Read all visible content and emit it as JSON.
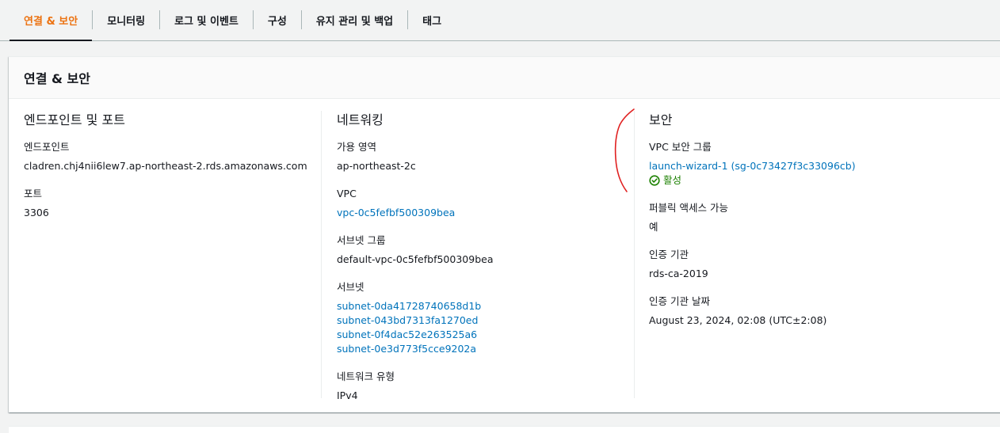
{
  "tabs": [
    {
      "label": "연결 & 보안",
      "active": true
    },
    {
      "label": "모니터링",
      "active": false
    },
    {
      "label": "로그 및 이벤트",
      "active": false
    },
    {
      "label": "구성",
      "active": false
    },
    {
      "label": "유지 관리 및 백업",
      "active": false
    },
    {
      "label": "태그",
      "active": false
    }
  ],
  "panel": {
    "title": "연결 & 보안"
  },
  "endpoint_section": {
    "title": "엔드포인트 및 포트",
    "endpoint_label": "엔드포인트",
    "endpoint_value": "cladren.chj4nii6lew7.ap-northeast-2.rds.amazonaws.com",
    "port_label": "포트",
    "port_value": "3306"
  },
  "networking_section": {
    "title": "네트워킹",
    "az_label": "가용 영역",
    "az_value": "ap-northeast-2c",
    "vpc_label": "VPC",
    "vpc_value": "vpc-0c5fefbf500309bea",
    "subnet_group_label": "서브넷 그룹",
    "subnet_group_value": "default-vpc-0c5fefbf500309bea",
    "subnets_label": "서브넷",
    "subnets": [
      "subnet-0da41728740658d1b",
      "subnet-043bd7313fa1270ed",
      "subnet-0f4dac52e263525a6",
      "subnet-0e3d773f5cce9202a"
    ],
    "network_type_label": "네트워크 유형",
    "network_type_value": "IPv4"
  },
  "security_section": {
    "title": "보안",
    "sg_label": "VPC 보안 그룹",
    "sg_value": "launch-wizard-1 (sg-0c73427f3c33096cb)",
    "sg_status": "활성",
    "public_label": "퍼블릭 액세스 가능",
    "public_value": "예",
    "ca_label": "인증 기관",
    "ca_value": "rds-ca-2019",
    "ca_date_label": "인증 기관 날짜",
    "ca_date_value": "August 23, 2024, 02:08 (UTC±2:08)"
  },
  "colors": {
    "accent": "#ec7211",
    "link": "#0073bb",
    "success": "#1d8102",
    "annotation": "#e02020"
  },
  "icons": {
    "status": "check-circle-icon"
  }
}
